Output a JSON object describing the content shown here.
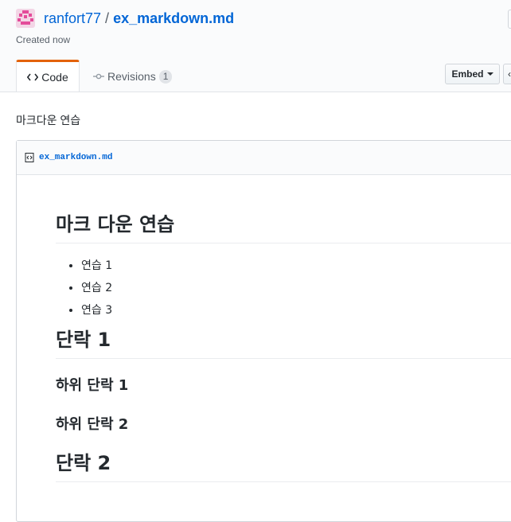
{
  "header": {
    "owner": "ranfort77",
    "separator": "/",
    "filename": "ex_markdown.md",
    "created": "Created now"
  },
  "tabs": {
    "code_label": "Code",
    "revisions_label": "Revisions",
    "revisions_count": "1"
  },
  "actions": {
    "embed_label": "Embed"
  },
  "gist": {
    "description": "마크다운 연습",
    "file_name": "ex_markdown.md"
  },
  "markdown": {
    "h1": "마크 다운 연습",
    "list": [
      "연습 1",
      "연습 2",
      "연습 3"
    ],
    "section1": "단락 1",
    "sub1": "하위 단락 1",
    "sub2": "하위 단락 2",
    "section2": "단락 2"
  },
  "colors": {
    "link": "#0366d6",
    "tab_accent": "#e36209",
    "avatar": "#e44c9a"
  }
}
